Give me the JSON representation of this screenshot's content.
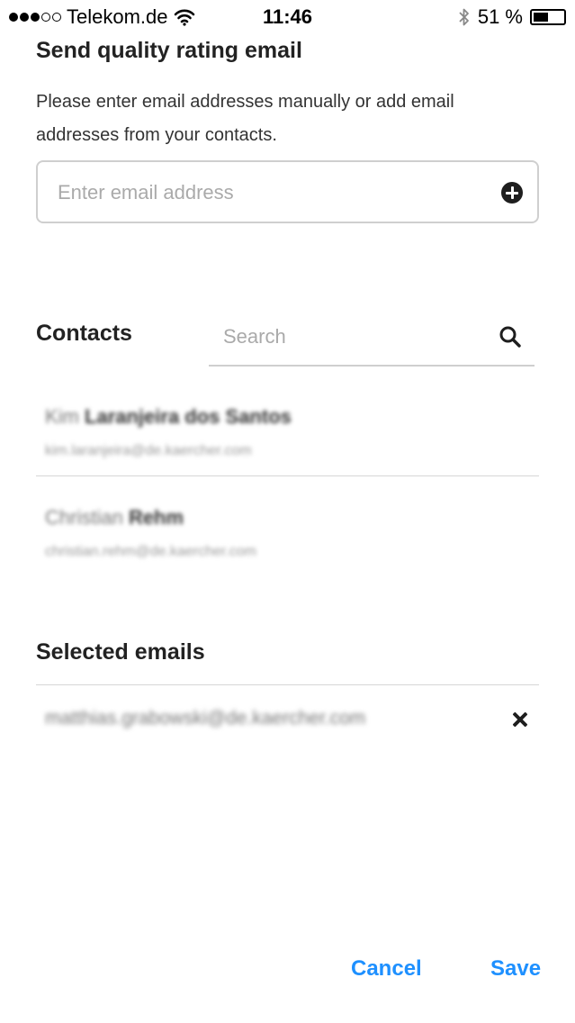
{
  "status_bar": {
    "carrier": "Telekom.de",
    "time": "11:46",
    "battery_percent_label": "51 %",
    "battery_level": 0.51,
    "signal_bars": 3,
    "signal_max": 5
  },
  "page": {
    "title": "Send quality rating email",
    "description": "Please enter email addresses manually or add email addresses from your contacts."
  },
  "email_entry": {
    "placeholder": "Enter email address",
    "value": ""
  },
  "contacts": {
    "title": "Contacts",
    "search_placeholder": "Search",
    "items": [
      {
        "first": "Kim",
        "last": "Laranjeira dos Santos",
        "email": "kim.laranjeira@de.kaercher.com"
      },
      {
        "first": "Christian",
        "last": "Rehm",
        "email": "christian.rehm@de.kaercher.com"
      }
    ]
  },
  "selected": {
    "title": "Selected emails",
    "items": [
      "matthias.grabowski@de.kaercher.com"
    ]
  },
  "actions": {
    "cancel_label": "Cancel",
    "save_label": "Save"
  },
  "colors": {
    "accent": "#1e90ff",
    "border": "#cfcfcf",
    "icon": "#1e1e1e"
  }
}
